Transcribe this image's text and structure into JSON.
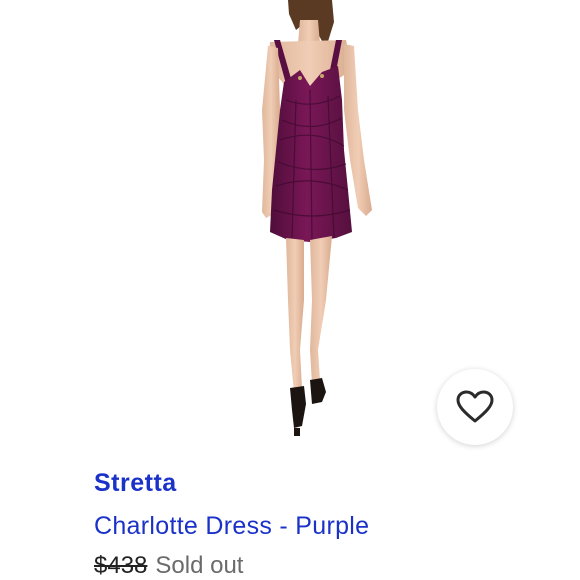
{
  "product": {
    "brand": "Stretta",
    "title": "Charlotte Dress - Purple",
    "original_price": "$438",
    "status": "Sold out",
    "image_alt": "Model wearing a purple bandage mini dress",
    "favorite_icon": "heart-outline-icon"
  },
  "colors": {
    "link": "#1a32c8",
    "dress": "#6e1450",
    "muted_text": "#6a6a6a"
  }
}
